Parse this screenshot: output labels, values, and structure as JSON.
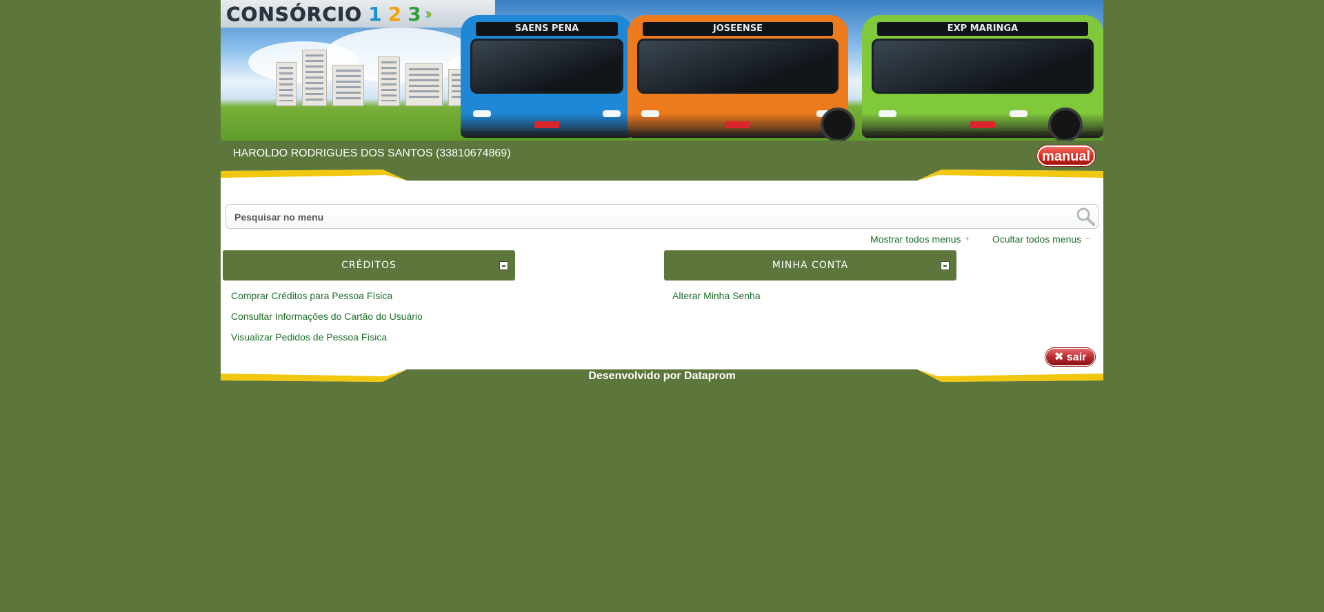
{
  "banner": {
    "logo_text": "CONSÓRCIO",
    "logo_numbers": [
      "1",
      "2",
      "3"
    ],
    "buses": [
      {
        "destination": "SAENS PENA",
        "color": "#1e87d6"
      },
      {
        "destination": "JOSEENSE",
        "color": "#ee7a1e"
      },
      {
        "destination": "EXP MARINGA",
        "color": "#7fc93b"
      }
    ]
  },
  "header": {
    "user": "HAROLDO RODRIGUES DOS SANTOS (33810674869)",
    "manual_label": "manual"
  },
  "search": {
    "placeholder": "Pesquisar no menu"
  },
  "menu_controls": {
    "show_all": "Mostrar todos menus",
    "show_all_symbol": "+",
    "hide_all": "Ocultar todos menus",
    "hide_all_symbol": "−"
  },
  "sections": [
    {
      "title": "CRÉDITOS",
      "items": [
        "Comprar Créditos para Pessoa Física",
        "Consultar Informações do Cartão do Usuário",
        "Visualizar Pedidos de Pessoa Física"
      ]
    },
    {
      "title": "MINHA CONTA",
      "items": [
        "Alterar Minha Senha"
      ]
    }
  ],
  "exit": {
    "label": "sair",
    "icon": "✖"
  },
  "footer": {
    "text": "Desenvolvido por Dataprom"
  },
  "colors": {
    "background": "#5d763c",
    "accent_yellow": "#f2c70f",
    "link": "#1f6d2a",
    "button_red": "#d8281f"
  }
}
